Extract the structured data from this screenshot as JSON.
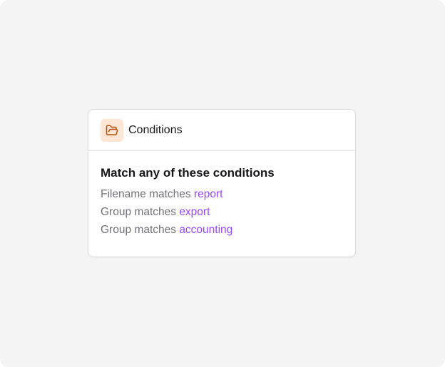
{
  "card": {
    "header": {
      "icon": "folder-open-icon",
      "title": "Conditions"
    },
    "title": "Match any of these conditions",
    "conditions": [
      {
        "field": "Filename",
        "operator": "matches",
        "value": "report"
      },
      {
        "field": "Group",
        "operator": "matches",
        "value": "export"
      },
      {
        "field": "Group",
        "operator": "matches",
        "value": "accounting"
      }
    ]
  },
  "colors": {
    "icon_background": "#fde6d4",
    "icon_stroke": "#b45309",
    "value_text": "#9747ff",
    "muted_text": "#71717a"
  }
}
